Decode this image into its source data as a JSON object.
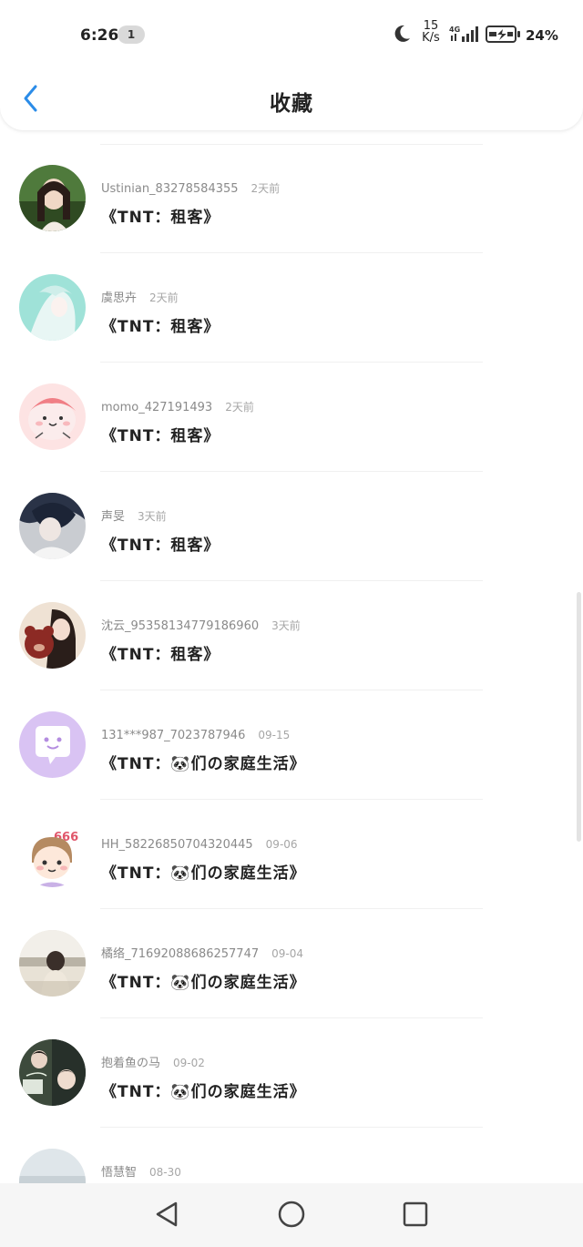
{
  "status_bar": {
    "time": "6:26",
    "notification_count": "1",
    "net_speed_value": "15",
    "net_speed_unit": "K/s",
    "network_type": "4G",
    "battery_percent": "24%"
  },
  "header": {
    "title": "收藏",
    "back_icon": "chevron-left-icon",
    "accent_color": "#2b8ce8"
  },
  "items": [
    {
      "username": "Ustinian_83278584355",
      "time": "2天前",
      "title": "《TNT：租客》"
    },
    {
      "username": "虞思卉",
      "time": "2天前",
      "title": "《TNT：租客》"
    },
    {
      "username": "momo_427191493",
      "time": "2天前",
      "title": "《TNT：租客》"
    },
    {
      "username": "声旻",
      "time": "3天前",
      "title": "《TNT：租客》"
    },
    {
      "username": "沈云_95358134779186960",
      "time": "3天前",
      "title": "《TNT：租客》"
    },
    {
      "username": "131***987_7023787946",
      "time": "09-15",
      "title": "《TNT：🐼们の家庭生活》"
    },
    {
      "username": "HH_58226850704320445",
      "time": "09-06",
      "title": "《TNT：🐼们の家庭生活》"
    },
    {
      "username": "橘络_71692088686257747",
      "time": "09-04",
      "title": "《TNT：🐼们の家庭生活》"
    },
    {
      "username": "抱着鱼の马",
      "time": "09-02",
      "title": "《TNT：🐼们の家庭生活》"
    },
    {
      "username": "悟慧智",
      "time": "08-30",
      "title": ""
    }
  ],
  "system_nav": {
    "back_icon": "triangle-back-icon",
    "home_icon": "circle-home-icon",
    "recents_icon": "square-recents-icon"
  }
}
